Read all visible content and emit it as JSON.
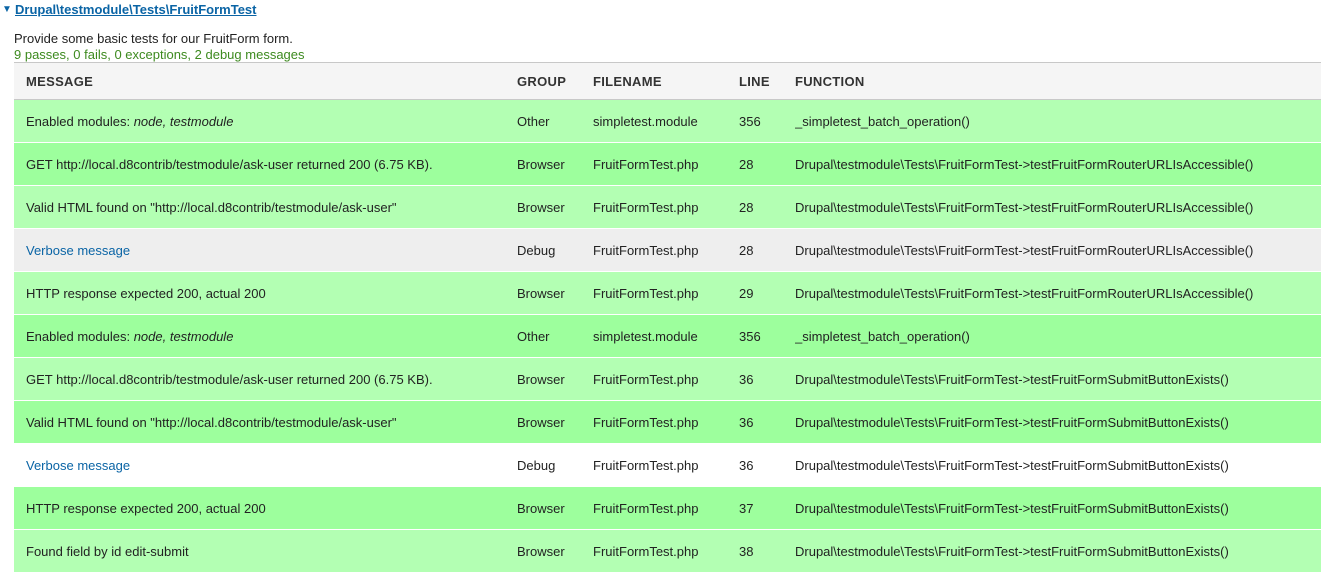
{
  "test": {
    "toggle_glyph": "▼",
    "name": "Drupal\\testmodule\\Tests\\FruitFormTest",
    "description": "Provide some basic tests for our FruitForm form.",
    "stats": "9 passes, 0 fails, 0 exceptions, 2 debug messages"
  },
  "columns": {
    "message": "MESSAGE",
    "group": "GROUP",
    "filename": "FILENAME",
    "line": "LINE",
    "function": "FUNCTION"
  },
  "rows": [
    {
      "message_prefix": "Enabled modules: ",
      "message_em": "node, testmodule",
      "group": "Other",
      "filename": "simpletest.module",
      "line": "356",
      "function": "_simpletest_batch_operation()",
      "status": "pass"
    },
    {
      "message": "GET http://local.d8contrib/testmodule/ask-user returned 200 (6.75 KB).",
      "group": "Browser",
      "filename": "FruitFormTest.php",
      "line": "28",
      "function": "Drupal\\testmodule\\Tests\\FruitFormTest->testFruitFormRouterURLIsAccessible()",
      "status": "pass"
    },
    {
      "message": "Valid HTML found on \"http://local.d8contrib/testmodule/ask-user\"",
      "group": "Browser",
      "filename": "FruitFormTest.php",
      "line": "28",
      "function": "Drupal\\testmodule\\Tests\\FruitFormTest->testFruitFormRouterURLIsAccessible()",
      "status": "pass"
    },
    {
      "message": "Verbose message",
      "group": "Debug",
      "filename": "FruitFormTest.php",
      "line": "28",
      "function": "Drupal\\testmodule\\Tests\\FruitFormTest->testFruitFormRouterURLIsAccessible()",
      "status": "debug"
    },
    {
      "message": "HTTP response expected 200, actual 200",
      "group": "Browser",
      "filename": "FruitFormTest.php",
      "line": "29",
      "function": "Drupal\\testmodule\\Tests\\FruitFormTest->testFruitFormRouterURLIsAccessible()",
      "status": "pass"
    },
    {
      "message_prefix": "Enabled modules: ",
      "message_em": "node, testmodule",
      "group": "Other",
      "filename": "simpletest.module",
      "line": "356",
      "function": "_simpletest_batch_operation()",
      "status": "pass"
    },
    {
      "message": "GET http://local.d8contrib/testmodule/ask-user returned 200 (6.75 KB).",
      "group": "Browser",
      "filename": "FruitFormTest.php",
      "line": "36",
      "function": "Drupal\\testmodule\\Tests\\FruitFormTest->testFruitFormSubmitButtonExists()",
      "status": "pass"
    },
    {
      "message": "Valid HTML found on \"http://local.d8contrib/testmodule/ask-user\"",
      "group": "Browser",
      "filename": "FruitFormTest.php",
      "line": "36",
      "function": "Drupal\\testmodule\\Tests\\FruitFormTest->testFruitFormSubmitButtonExists()",
      "status": "pass"
    },
    {
      "message": "Verbose message",
      "group": "Debug",
      "filename": "FruitFormTest.php",
      "line": "36",
      "function": "Drupal\\testmodule\\Tests\\FruitFormTest->testFruitFormSubmitButtonExists()",
      "status": "debug"
    },
    {
      "message": "HTTP response expected 200, actual 200",
      "group": "Browser",
      "filename": "FruitFormTest.php",
      "line": "37",
      "function": "Drupal\\testmodule\\Tests\\FruitFormTest->testFruitFormSubmitButtonExists()",
      "status": "pass"
    },
    {
      "message": "Found field by id edit-submit",
      "group": "Browser",
      "filename": "FruitFormTest.php",
      "line": "38",
      "function": "Drupal\\testmodule\\Tests\\FruitFormTest->testFruitFormSubmitButtonExists()",
      "status": "pass"
    }
  ],
  "colors": {
    "pass_light": "#b3ffb3",
    "pass_dark": "#9dff9d",
    "debug_light": "#ffffff",
    "debug_dark": "#eeeeee",
    "link": "#0a64a5",
    "stats": "#3d8a1f"
  }
}
